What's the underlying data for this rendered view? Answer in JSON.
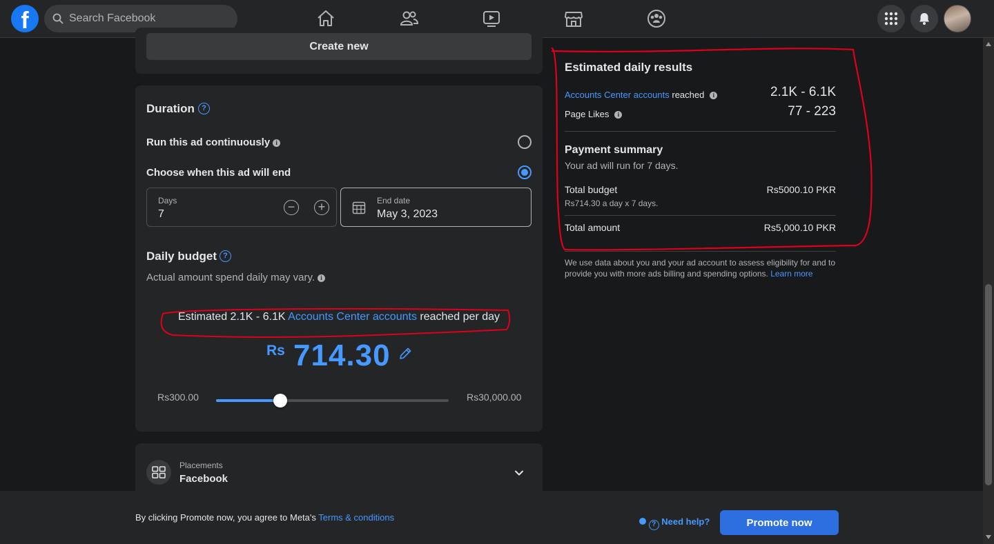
{
  "topbar": {
    "logo": "f",
    "search_placeholder": "Search Facebook",
    "nav_icons": [
      "home-icon",
      "friends-icon",
      "watch-icon",
      "marketplace-icon",
      "groups-icon"
    ],
    "right_icons": [
      "menu-grid-icon",
      "notifications-icon",
      "avatar"
    ]
  },
  "create_new_label": "Create new",
  "duration": {
    "title": "Duration",
    "option_continuous": "Run this ad continuously",
    "option_choose_end": "Choose when this ad will end",
    "selected": "choose_end",
    "days_label": "Days",
    "days_value": "7",
    "end_date_label": "End date",
    "end_date_value": "May 3, 2023"
  },
  "budget": {
    "title": "Daily budget",
    "subtitle": "Actual amount spend daily may vary.",
    "estimate_prefix": "Estimated 2.1K - 6.1K ",
    "estimate_link": "Accounts Center accounts",
    "estimate_suffix": " reached per day",
    "currency": "Rs",
    "amount": "714.30",
    "min_label": "Rs300.00",
    "max_label": "Rs30,000.00",
    "slider_fraction": 0.275
  },
  "placements": {
    "label": "Placements",
    "value": "Facebook"
  },
  "results": {
    "title": "Estimated daily results",
    "reach_link": "Accounts Center accounts",
    "reach_suffix": " reached",
    "reach_value": "2.1K - 6.1K",
    "likes_label": "Page Likes",
    "likes_value": "77 - 223"
  },
  "payment": {
    "title": "Payment summary",
    "subtitle": "Your ad will run for 7 days.",
    "total_budget_label": "Total budget",
    "total_budget_value": "Rs5000.10 PKR",
    "total_budget_detail": "Rs714.30 a day x 7 days.",
    "total_amount_label": "Total amount",
    "total_amount_value": "Rs5,000.10 PKR",
    "disclaimer": "We use data about you and your ad account to assess eligibility for and to provide you with more ads billing and spending options.",
    "learn_more": "Learn more"
  },
  "footer": {
    "agree_prefix": "By clicking Promote now, you agree to Meta's ",
    "terms_link": "Terms & conditions",
    "help_label": "Need help?",
    "promote_label": "Promote now"
  },
  "colors": {
    "background": "#18191a",
    "card": "#242526",
    "accent": "#4599ff",
    "button_primary": "#2d6fe0",
    "annotation": "#e0001b"
  }
}
